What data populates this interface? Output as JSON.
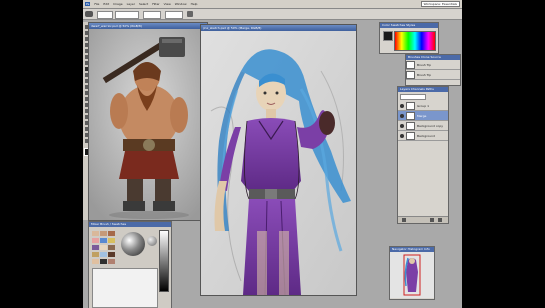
{
  "app": {
    "menu": [
      "File",
      "Edit",
      "Image",
      "Layer",
      "Select",
      "Filter",
      "View",
      "Window",
      "Help"
    ],
    "workspace_label": "Workspace: Essentials"
  },
  "windows": {
    "reference": {
      "title": "dwarf_warrior.psd @ 50% (RGB/8)"
    },
    "main": {
      "title": "jinx_sketch.psd @ 50% (Merge, RGB/8)"
    }
  },
  "panels": {
    "color": {
      "title": "Color  Swatches  Styles"
    },
    "brushes": {
      "title": "Brushes  Clone Source"
    },
    "brush_rows": [
      "Brush Tip",
      "Brush Tip",
      "Brush Tip"
    ],
    "layers": {
      "title": "Layers  Channels  Paths",
      "rows": [
        {
          "name": "Group 1",
          "active": false
        },
        {
          "name": "Merge",
          "active": true
        },
        {
          "name": "Background copy",
          "active": false
        },
        {
          "name": "Background",
          "active": false
        }
      ]
    },
    "navigator": {
      "title": "Navigator  Histogram  Info"
    },
    "mixer": {
      "title": "Mixer Brush / Swatches"
    }
  },
  "colors": {
    "foreground": "#1a1a1a",
    "background": "#ffffff",
    "purple": "#7b3fa6",
    "hair": "#3a8fd0"
  }
}
